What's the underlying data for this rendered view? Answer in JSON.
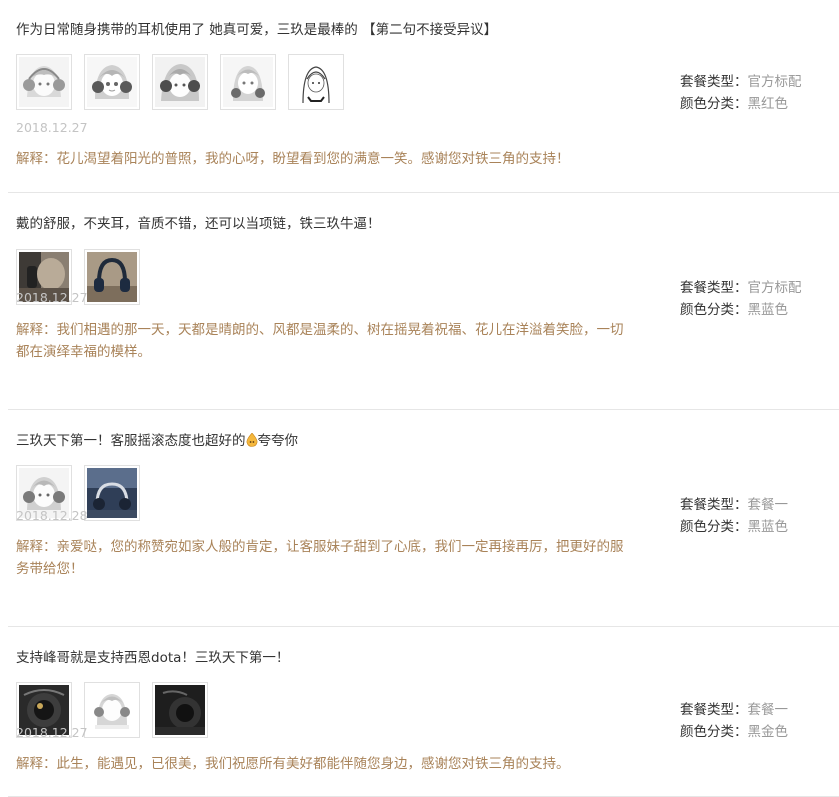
{
  "reviews": [
    {
      "text": "作为日常随身携带的耳机使用了 她真可爱，三玖是最棒的 【第二句不接受异议】",
      "date": "2018.12.27",
      "reply_prefix": "解释：",
      "reply": "花儿渴望着阳光的普照，我的心呀，盼望看到您的满意一笑。感谢您对铁三角的支持！",
      "meta": {
        "package_label": "套餐类型：",
        "package_value": "官方标配",
        "color_label": "颜色分类：",
        "color_value": "黑红色"
      },
      "photos": [
        "anime-girl-headphones-photo",
        "anime-girl-headphones-photo",
        "anime-girl-headphones-photo",
        "anime-girl-headphones-photo",
        "anime-girl-sketch-photo"
      ]
    },
    {
      "text": "戴的舒服，不夹耳，音质不错，还可以当项链，铁三玖牛逼！",
      "date": "2018.12.27",
      "reply_prefix": "解释：",
      "reply": "我们相遇的那一天，天都是晴朗的、风都是温柔的、树在摇晃着祝福、花儿在洋溢着笑脸，一切都在演绎幸福的模样。",
      "meta": {
        "package_label": "套餐类型：",
        "package_value": "官方标配",
        "color_label": "颜色分类：",
        "color_value": "黑蓝色"
      },
      "photos": [
        "wearing-headphones-photo",
        "blue-headphones-photo"
      ]
    },
    {
      "text": "三玖天下第一！客服摇滚态度也超好的",
      "text_suffix": "夸夸你",
      "date": "2018.12.28",
      "reply_prefix": "解释：",
      "reply": "亲爱哒，您的称赞宛如家人般的肯定，让客服妹子甜到了心底，我们一定再接再厉，把更好的服务带给您！",
      "meta": {
        "package_label": "套餐类型：",
        "package_value": "套餐一",
        "color_label": "颜色分类：",
        "color_value": "黑蓝色"
      },
      "photos": [
        "anime-girl-headphones-photo",
        "headphones-on-desk-photo"
      ]
    },
    {
      "text": "支持峰哥就是支持西恩dota！三玖天下第一！",
      "date": "2018.12.27",
      "reply_prefix": "解释：",
      "reply": "此生，能遇见，已很美，我们祝愿所有美好都能伴随您身边，感谢您对铁三角的支持。",
      "meta": {
        "package_label": "套餐类型：",
        "package_value": "套餐一",
        "color_label": "颜色分类：",
        "color_value": "黑金色"
      },
      "photos": [
        "headphones-closeup-photo",
        "anime-girl-headphones-photo",
        "headphones-dark-photo"
      ]
    }
  ],
  "colors": {
    "reply": "#a98359",
    "date": "#c4c4c4",
    "meta_value": "#999999",
    "divider": "#e6e6e6"
  }
}
